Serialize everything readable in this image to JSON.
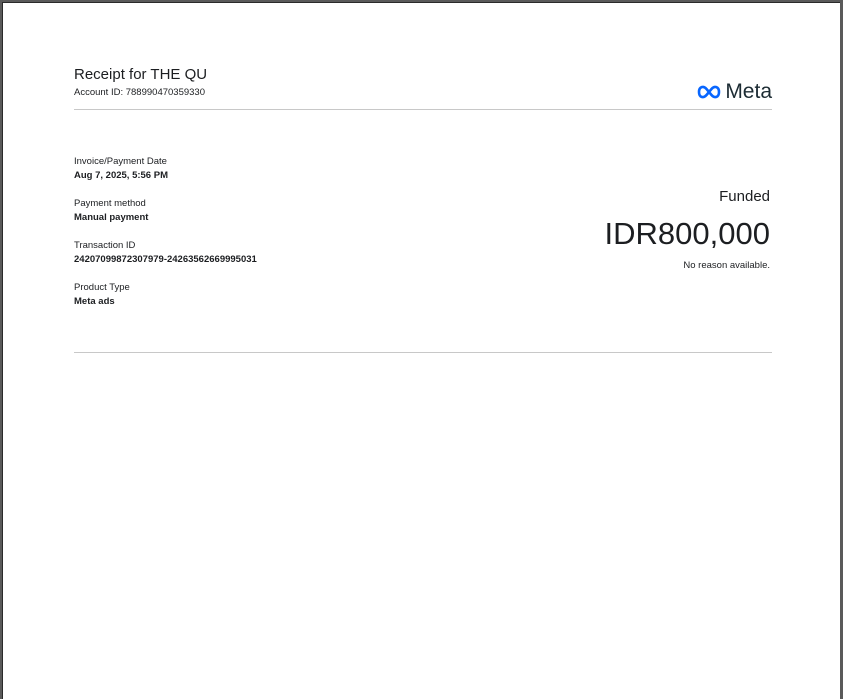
{
  "receipt": {
    "title": "Receipt for THE QU",
    "account_id": "Account ID: 788990470359330"
  },
  "brand": {
    "name": "Meta",
    "icon": "meta-infinity-logo",
    "color": "#0866ff"
  },
  "details": [
    {
      "label": "Invoice/Payment Date",
      "value": "Aug 7, 2025, 5:56 PM"
    },
    {
      "label": "Payment method",
      "value": "Manual payment"
    },
    {
      "label": "Transaction ID",
      "value": "24207099872307979-24263562669995031"
    },
    {
      "label": "Product Type",
      "value": "Meta ads"
    }
  ],
  "summary": {
    "status": "Funded",
    "amount": "IDR800,000",
    "reason": "No reason available."
  }
}
